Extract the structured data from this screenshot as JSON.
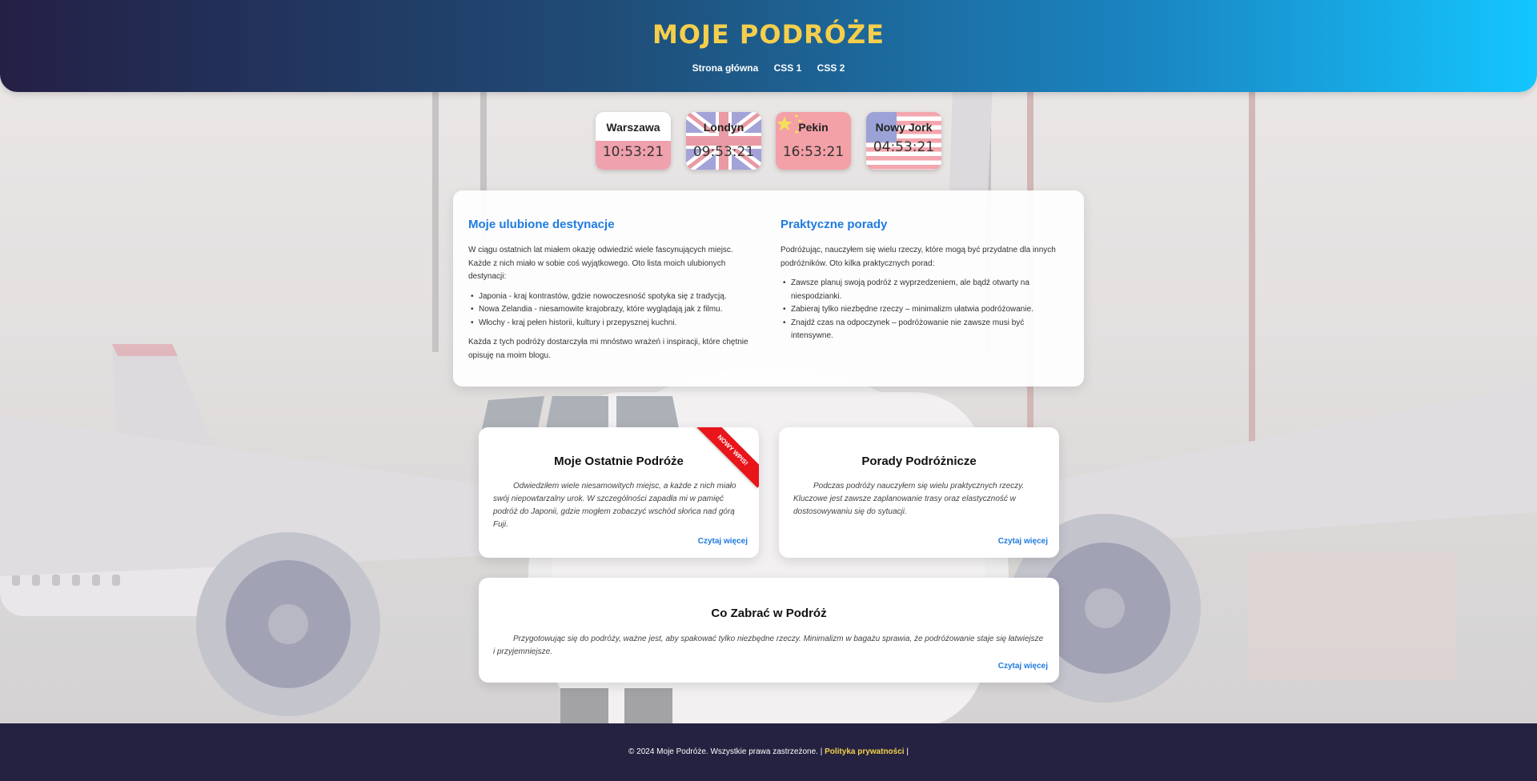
{
  "header": {
    "title": "MOJE PODRÓŻE",
    "nav": [
      "Strona główna",
      "CSS 1",
      "CSS 2"
    ]
  },
  "clocks": [
    {
      "city": "Warszawa",
      "time": "10:53:21",
      "flag": "poland-flag"
    },
    {
      "city": "Londyn",
      "time": "09:53:21",
      "flag": "uk-flag"
    },
    {
      "city": "Pekin",
      "time": "16:53:21",
      "flag": "china-flag"
    },
    {
      "city": "Nowy Jork",
      "time": "04:53:21",
      "flag": "usa-flag"
    }
  ],
  "info": {
    "destinations": {
      "heading": "Moje ulubione destynacje",
      "intro": "W ciągu ostatnich lat miałem okazję odwiedzić wiele fascynujących miejsc. Każde z nich miało w sobie coś wyjątkowego. Oto lista moich ulubionych destynacji:",
      "items": [
        "Japonia - kraj kontrastów, gdzie nowoczesność spotyka się z tradycją.",
        "Nowa Zelandia - niesamowite krajobrazy, które wyglądają jak z filmu.",
        "Włochy - kraj pełen historii, kultury i przepysznej kuchni."
      ],
      "outro": "Każda z tych podróży dostarczyła mi mnóstwo wrażeń i inspiracji, które chętnie opisuję na moim blogu."
    },
    "tips": {
      "heading": "Praktyczne porady",
      "intro": "Podróżując, nauczyłem się wielu rzeczy, które mogą być przydatne dla innych podróżników. Oto kilka praktycznych porad:",
      "items": [
        "Zawsze planuj swoją podróż z wyprzedzeniem, ale bądź otwarty na niespodzianki.",
        "Zabieraj tylko niezbędne rzeczy – minimalizm ułatwia podróżowanie.",
        "Znajdź czas na odpoczynek – podróżowanie nie zawsze musi być intensywne."
      ]
    }
  },
  "cards": {
    "recent": {
      "title": "Moje Ostatnie Podróże",
      "ribbon": "NOWY WPIS!",
      "text": "Odwiedziłem wiele niesamowitych miejsc, a każde z nich miało swój niepowtarzalny urok. W szczególności zapadła mi w pamięć podróż do Japonii, gdzie mogłem zobaczyć wschód słońca nad górą Fuji.",
      "link": "Czytaj więcej"
    },
    "tips": {
      "title": "Porady Podróżnicze",
      "text": "Podczas podróży nauczyłem się wielu praktycznych rzeczy. Kluczowe jest zawsze zaplanowanie trasy oraz elastyczność w dostosowywaniu się do sytuacji.",
      "link": "Czytaj więcej"
    },
    "packing": {
      "title": "Co Zabrać w Podróż",
      "text": "Przygotowując się do podróży, ważne jest, aby spakować tylko niezbędne rzeczy. Minimalizm w bagażu sprawia, że podróżowanie staje się łatwiejsze i przyjemniejsze.",
      "link": "Czytaj więcej"
    }
  },
  "footer": {
    "copyright": "© 2024 Moje Podróże. Wszystkie prawa zastrzeżone. |",
    "privacy": "Polityka prywatności",
    "separator": "|"
  },
  "colors": {
    "title_yellow": "#f5cf4c",
    "accent_blue": "#1f7be0",
    "ribbon_red": "#e8151b",
    "footer_bg": "#242240"
  }
}
